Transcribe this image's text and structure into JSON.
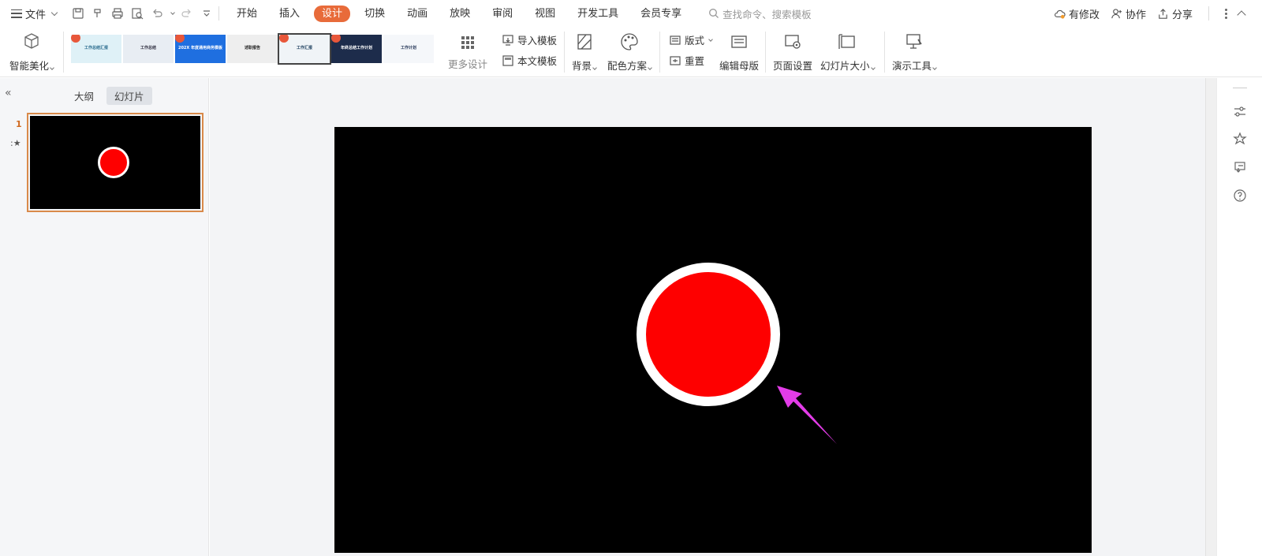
{
  "menubar": {
    "file_label": "文件",
    "tabs": [
      {
        "label": "开始"
      },
      {
        "label": "插入"
      },
      {
        "label": "设计"
      },
      {
        "label": "切换"
      },
      {
        "label": "动画"
      },
      {
        "label": "放映"
      },
      {
        "label": "审阅"
      },
      {
        "label": "视图"
      },
      {
        "label": "开发工具"
      },
      {
        "label": "会员专享"
      }
    ],
    "active_tab": "设计",
    "search_placeholder": "查找命令、搜索模板",
    "right": {
      "modified": "有修改",
      "collaborate": "协作",
      "share": "分享"
    }
  },
  "ribbon": {
    "smart_beautify": "智能美化",
    "more_design": "更多设计",
    "import_template": "导入模板",
    "this_template": "本文模板",
    "background": "背景",
    "color_scheme": "配色方案",
    "layout": "版式",
    "reset": "重置",
    "edit_master": "编辑母版",
    "page_setup": "页面设置",
    "slide_size": "幻灯片大小",
    "present_tools": "演示工具",
    "templates": [
      {
        "title": "工作总结汇报",
        "bg": "#dff1f7",
        "fg": "#2c6d8f"
      },
      {
        "title": "工作总结",
        "bg": "#e8edf3",
        "fg": "#334"
      },
      {
        "title": "202X 年度通用商务模板",
        "bg": "#1f6fe0",
        "fg": "#ffffff"
      },
      {
        "title": "述职报告",
        "bg": "#eeeeee",
        "fg": "#222"
      },
      {
        "title": "工作汇报",
        "bg": "#f0f4f7",
        "fg": "#1d3f5e"
      },
      {
        "title": "年终总结工作计划",
        "bg": "#1d2c4b",
        "fg": "#ffffff"
      },
      {
        "title": "工作计划",
        "bg": "#f5f7fa",
        "fg": "#2a3b5c"
      }
    ]
  },
  "left_panel": {
    "tab_outline": "大纲",
    "tab_slides": "幻灯片",
    "slide_number": "1"
  },
  "colors": {
    "accent": "#e86b3a",
    "circle_fill": "#fe0000",
    "arrow": "#e33ce8",
    "slide_bg": "#000000"
  }
}
